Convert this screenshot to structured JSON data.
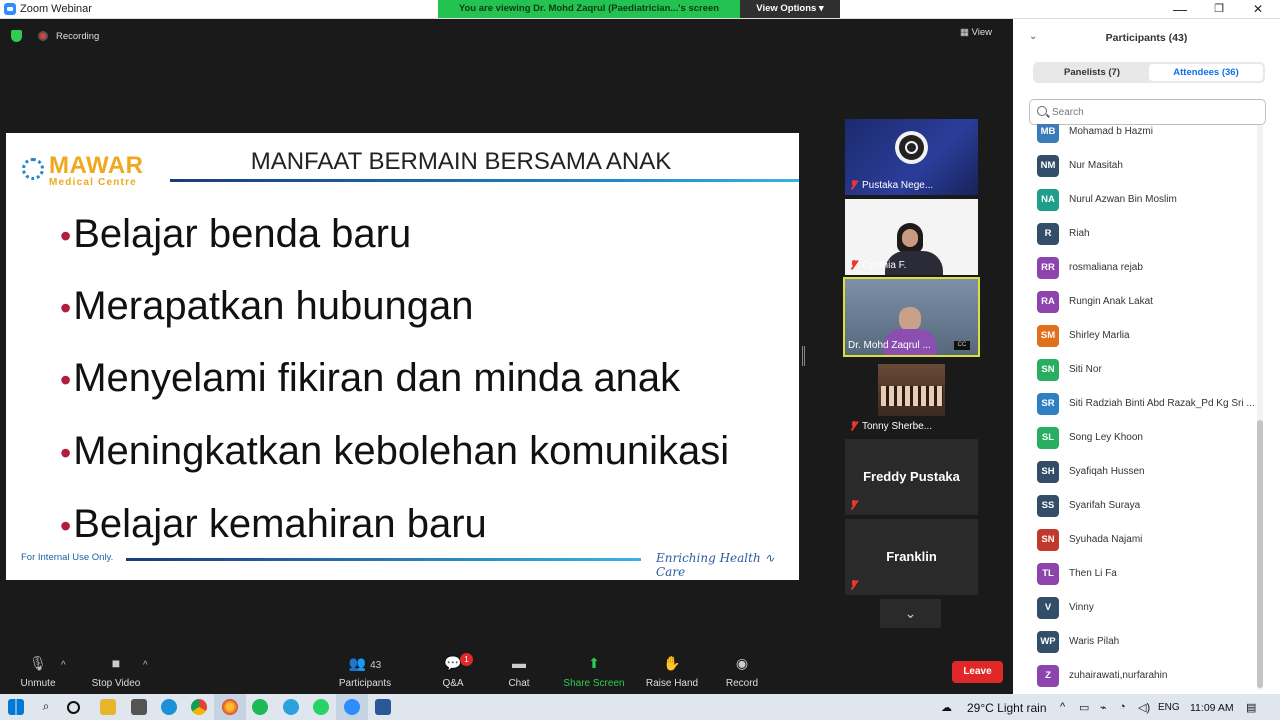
{
  "window": {
    "title": "Zoom Webinar",
    "minimize": "—",
    "restore": "❐",
    "close": "✕"
  },
  "banner": {
    "viewing_text": "You are viewing Dr. Mohd Zaqrul (Paediatrician...'s screen",
    "view_options": "View Options ▾"
  },
  "meeting": {
    "recording_label": "Recording",
    "view_label": "View"
  },
  "slide": {
    "logo_name": "MAWAR",
    "logo_sub": "Medical Centre",
    "title": "MANFAAT BERMAIN BERSAMA ANAK",
    "bullets": [
      "Belajar benda baru",
      "Merapatkan hubungan",
      "Menyelami fikiran dan minda anak",
      "Meningkatkan kebolehan komunikasi",
      "Belajar kemahiran baru"
    ],
    "footer_left": "For Internal Use Only.",
    "footer_right": "Enriching Health ∿ Care"
  },
  "videos": [
    {
      "name": "Pustaka Nege..."
    },
    {
      "name": "Cynthia F."
    },
    {
      "name": "Dr. Mohd Zaqrul ...",
      "badge": "CC"
    },
    {
      "name": "Tonny Sherbe..."
    },
    {
      "name": "Freddy Pustaka"
    },
    {
      "name": "Franklin"
    }
  ],
  "controls": {
    "unmute": "Unmute",
    "stop_video": "Stop Video",
    "participants": "Participants",
    "participants_count": "43",
    "qa": "Q&A",
    "qa_badge": "1",
    "chat": "Chat",
    "share_screen": "Share Screen",
    "raise_hand": "Raise Hand",
    "record": "Record",
    "leave": "Leave"
  },
  "panel": {
    "title": "Participants (43)",
    "tab_panelists": "Panelists (7)",
    "tab_attendees": "Attendees (36)",
    "search_placeholder": "Search",
    "attendees": [
      {
        "initials": "MB",
        "name": "Mohamad b Hazmi",
        "color": "#3a7bb8"
      },
      {
        "initials": "NM",
        "name": "Nur Masitah",
        "color": "#334e68"
      },
      {
        "initials": "NA",
        "name": "Nurul Azwan Bin Moslim",
        "color": "#1f9e89"
      },
      {
        "initials": "R",
        "name": "Riah",
        "color": "#334e68"
      },
      {
        "initials": "RR",
        "name": "rosmaliana rejab",
        "color": "#8e44ad"
      },
      {
        "initials": "RA",
        "name": "Rungin Anak Lakat",
        "color": "#8e44ad"
      },
      {
        "initials": "SM",
        "name": "Shirley Marlia",
        "color": "#e0701b"
      },
      {
        "initials": "SN",
        "name": "Siti Nor",
        "color": "#27ae60"
      },
      {
        "initials": "SR",
        "name": "Siti Radziah Binti Abd Razak_Pd Kg Sri ...",
        "color": "#2f80c2"
      },
      {
        "initials": "SL",
        "name": "Song Ley Khoon",
        "color": "#27ae60"
      },
      {
        "initials": "SH",
        "name": "Syafiqah Hussen",
        "color": "#334e68"
      },
      {
        "initials": "SS",
        "name": "Syarifah Suraya",
        "color": "#334e68"
      },
      {
        "initials": "SN",
        "name": "Syuhada Najami",
        "color": "#c0392b"
      },
      {
        "initials": "TL",
        "name": "Then Li Fa",
        "color": "#8e44ad"
      },
      {
        "initials": "V",
        "name": "Vinny",
        "color": "#334e68"
      },
      {
        "initials": "WP",
        "name": "Waris Pilah",
        "color": "#334e68"
      },
      {
        "initials": "Z",
        "name": "zuhairawati,nurfarahin",
        "color": "#8e44ad"
      }
    ]
  },
  "taskbar": {
    "weather": "29°C  Light rain",
    "language": "ENG",
    "time": "11:09 AM"
  }
}
